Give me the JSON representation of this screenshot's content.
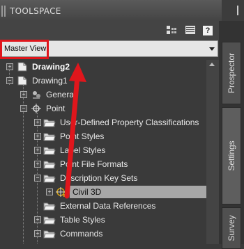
{
  "app": {
    "title": "TOOLSPACE"
  },
  "dropdown": {
    "value": "Master View"
  },
  "toolbar": {
    "help_label": "?"
  },
  "tree": [
    {
      "label": "Drawing2",
      "bold": true
    },
    {
      "label": "Drawing1",
      "bold": false
    },
    {
      "label": "General"
    },
    {
      "label": "Point"
    },
    {
      "label": "User-Defined Property Classifications"
    },
    {
      "label": "Point Styles"
    },
    {
      "label": "Label Styles"
    },
    {
      "label": "Point File Formats"
    },
    {
      "label": "Description Key Sets"
    },
    {
      "label": "Civil 3D"
    },
    {
      "label": "External Data References"
    },
    {
      "label": "Table Styles"
    },
    {
      "label": "Commands"
    }
  ],
  "tabs": [
    {
      "label": "Prospector"
    },
    {
      "label": "Settings"
    },
    {
      "label": "Survey"
    }
  ],
  "colors": {
    "highlight": "#e0161c",
    "selection": "#a7a7a7"
  }
}
